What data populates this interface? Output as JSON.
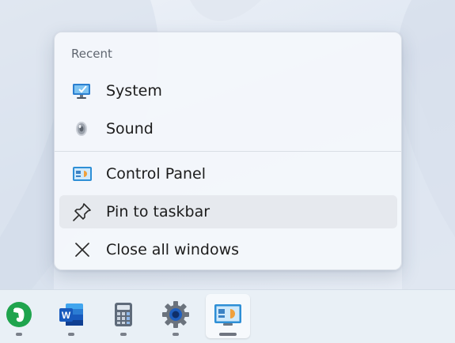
{
  "jumplist": {
    "section_header": "Recent",
    "recent_items": [
      {
        "label": "System",
        "icon": "monitor-check-icon"
      },
      {
        "label": "Sound",
        "icon": "speaker-icon"
      }
    ],
    "tasks": [
      {
        "label": "Control Panel",
        "icon": "control-panel-icon"
      },
      {
        "label": "Pin to taskbar",
        "icon": "pin-icon"
      },
      {
        "label": "Close all windows",
        "icon": "close-icon"
      }
    ]
  },
  "taskbar": {
    "apps": [
      {
        "icon": "evernote-icon"
      },
      {
        "icon": "word-icon",
        "letter": "W"
      },
      {
        "icon": "calculator-icon"
      },
      {
        "icon": "settings-gear-icon"
      },
      {
        "icon": "control-panel-icon",
        "active": true
      }
    ]
  },
  "colors": {
    "evernote_green": "#1fa44d",
    "word_blue": "#185abd",
    "settings_blue": "#1f5fbf",
    "control_panel_blue": "#2e8fd6"
  }
}
